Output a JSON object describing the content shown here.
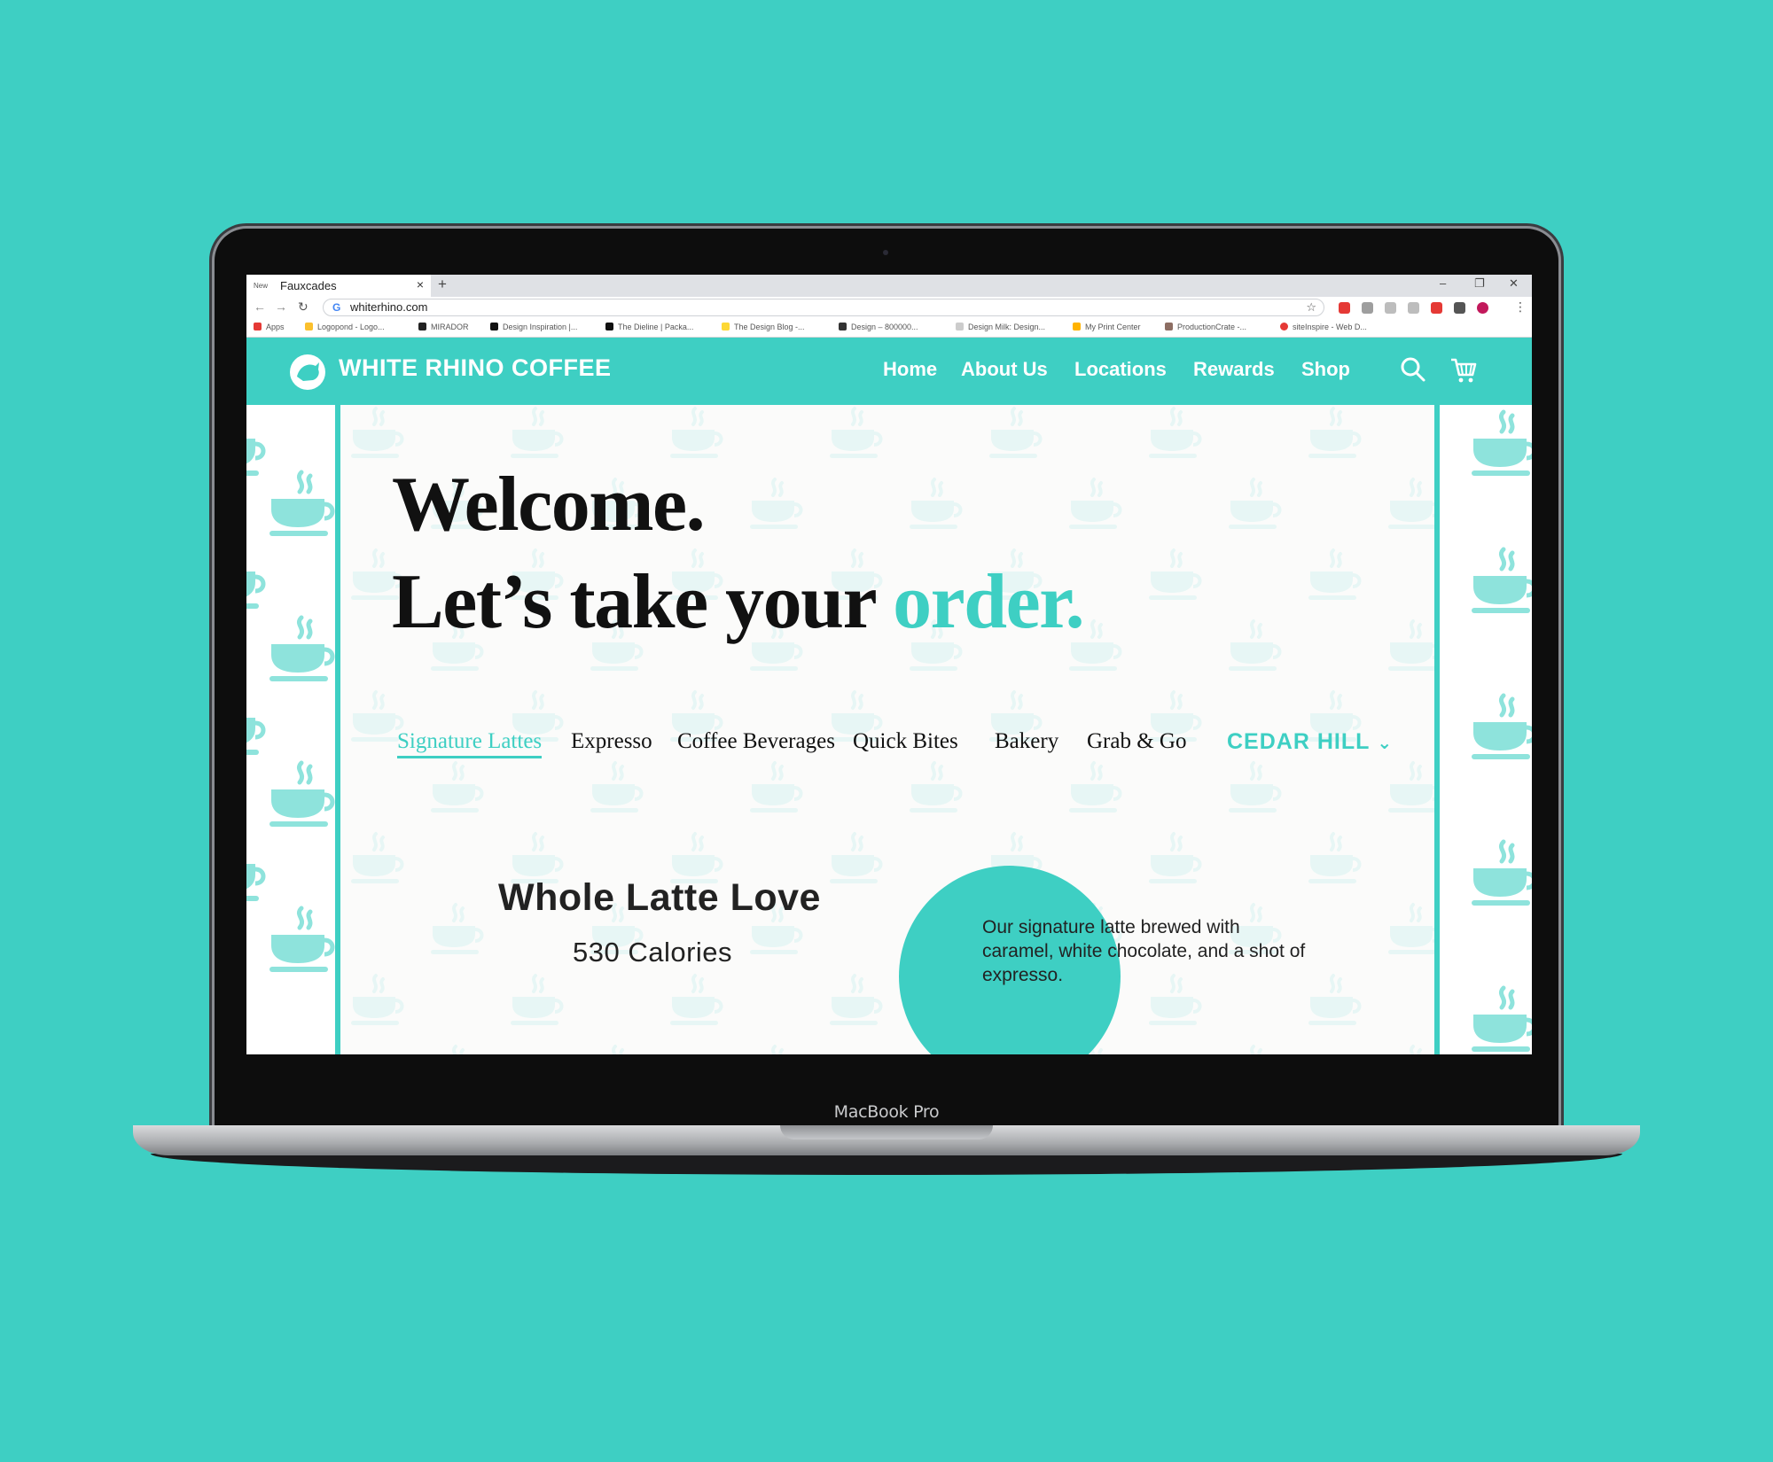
{
  "device": {
    "model_label": "MacBook Pro"
  },
  "browser": {
    "tab": {
      "title": "Fauxcades",
      "favicon_text": "New"
    },
    "url": "whiterhino.com",
    "bookmarks": [
      "Apps",
      "Logopond - Logo...",
      "MIRADOR",
      "Design Inspiration |...",
      "The Dieline | Packa...",
      "The Design Blog -...",
      "Design – 800000...",
      "Design Milk: Design...",
      "My Print Center",
      "ProductionCrate -...",
      "siteInspire - Web D..."
    ]
  },
  "site": {
    "brand": "WHITE RHINO COFFEE",
    "nav": [
      "Home",
      "About Us",
      "Locations",
      "Rewards",
      "Shop"
    ],
    "hero": {
      "line1": "Welcome.",
      "line2_prefix": "Let’s take your ",
      "line2_accent": "order."
    },
    "menu_tabs": [
      "Signature Lattes",
      "Expresso",
      "Coffee Beverages",
      "Quick Bites",
      "Bakery",
      "Grab & Go"
    ],
    "active_tab": "Signature Lattes",
    "location": "CEDAR HILL",
    "product": {
      "name": "Whole Latte Love",
      "calories": "530 Calories",
      "description": "Our signature latte brewed with caramel, white chocolate, and a shot of expresso."
    }
  },
  "colors": {
    "accent": "#3ecfc3",
    "text": "#111111",
    "background": "#3ecfc3"
  }
}
